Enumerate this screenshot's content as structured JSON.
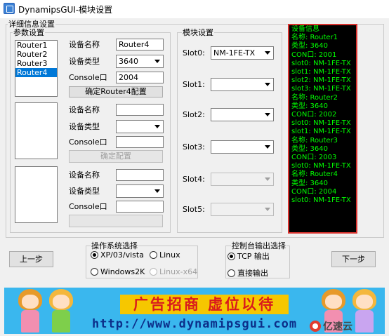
{
  "window": {
    "title": "DynamipsGUI-模块设置"
  },
  "detail_group": {
    "label": "详细信息设置"
  },
  "param_group": {
    "label": "参数设置"
  },
  "router_list": [
    "Router1",
    "Router2",
    "Router3",
    "Router4"
  ],
  "selected_router": "Router4",
  "block1": {
    "name_label": "设备名称",
    "name_value": "Router4",
    "type_label": "设备类型",
    "type_value": "3640",
    "console_label": "Console口",
    "console_value": "2004",
    "confirm_label": "确定Router4配置"
  },
  "block2": {
    "name_label": "设备名称",
    "type_label": "设备类型",
    "console_label": "Console口",
    "confirm_label": "确定配置"
  },
  "block3": {
    "name_label": "设备名称",
    "type_label": "设备类型",
    "console_label": "Console口"
  },
  "module_group": {
    "label": "模块设置"
  },
  "slots": [
    {
      "label": "Slot0:",
      "value": "NM-1FE-TX",
      "enabled": true
    },
    {
      "label": "Slot1:",
      "value": "",
      "enabled": true
    },
    {
      "label": "Slot2:",
      "value": "",
      "enabled": true
    },
    {
      "label": "Slot3:",
      "value": "",
      "enabled": true
    },
    {
      "label": "Slot4:",
      "value": "",
      "enabled": false
    },
    {
      "label": "Slot5:",
      "value": "",
      "enabled": false
    }
  ],
  "console_lines": [
    "设备信息",
    "名称: Router1",
    "类型: 3640",
    "CON口: 2001",
    "slot0: NM-1FE-TX",
    "slot1: NM-1FE-TX",
    "slot2: NM-1FE-TX",
    "slot3: NM-1FE-TX",
    "名称: Router2",
    "类型: 3640",
    "CON口: 2002",
    "slot0: NM-1FE-TX",
    "slot1: NM-1FE-TX",
    "名称: Router3",
    "类型: 3640",
    "CON口: 2003",
    "slot0: NM-1FE-TX",
    "名称: Router4",
    "类型: 3640",
    "CON口: 2004",
    "slot0: NM-1FE-TX"
  ],
  "nav": {
    "prev": "上一步",
    "next": "下一步"
  },
  "os_group": {
    "label": "操作系统选择",
    "options": [
      "XP/03/vista",
      "Linux",
      "Windows2K",
      "Linux-x64"
    ]
  },
  "console_out_group": {
    "label": "控制台输出选择",
    "options": [
      "TCP 输出",
      "直接输出"
    ]
  },
  "banner": {
    "slogan": "广告招商 虚位以待",
    "url": "http://www.dynamipsgui.com"
  },
  "watermark": {
    "text": "亿速云"
  },
  "colors": {
    "console_text": "#00ff00",
    "console_border": "#d9322e",
    "selection": "#0078d7",
    "banner_bg": "#3ab7ee"
  }
}
